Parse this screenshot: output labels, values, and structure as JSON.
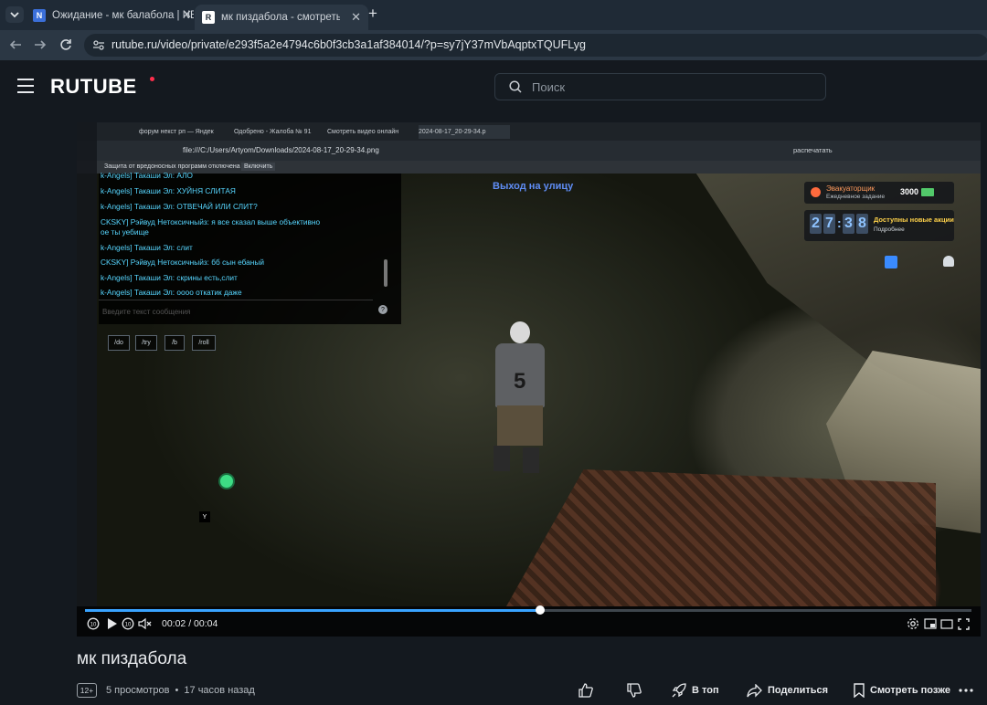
{
  "browser": {
    "tabs": [
      {
        "title": "Ожидание - мк балабола | NE",
        "favicon": "nextrp-icon"
      },
      {
        "title": "мк пиздабола - смотреть виде",
        "favicon": "rutube-icon",
        "active": true
      }
    ],
    "new_tab": "+",
    "url": "rutube.ru/video/private/e293f5a2e4794c6b0f3cb3a1af384014/?p=sy7jY37mVbAqptxTQUFLyg"
  },
  "rutube": {
    "logo": "RUTUBE",
    "search_placeholder": "Поиск"
  },
  "video": {
    "inner_tabs": [
      "форум некст рп — Яндек",
      "Одобрено - Жалоба № 91",
      "Смотреть видео онлайн",
      "2024-08-17_20-29-34.p"
    ],
    "inner_url": "file:///C:/Users/Artyom/Downloads/2024-08-17_20-29-34.png",
    "inner_warning": "Защита от вредоносных программ отключена",
    "inner_enable": "Включить",
    "inner_translate": "распечатать",
    "chat": [
      "k-Angels] Такаши Эл: АЛО",
      "k-Angels] Такаши Эл: ХУЙНЯ СЛИТАЯ",
      "k-Angels] Такаши Эл: ОТВЕЧАЙ ИЛИ СЛИТ?",
      "CKSKY] Рэйвуд Нетоксичныйз: я все сказал выше объективно",
      "ое ты уебище",
      "k-Angels] Такаши Эл: слит",
      "CKSKY] Рэйвуд Нетоксичныйз: бб сын ебаный",
      "k-Angels] Такаши Эл: скрины есть,слит",
      "k-Angels] Такаши Эл: оооо откатик даже"
    ],
    "chat_placeholder": "Введите текст сообщения",
    "commands": [
      "/do",
      "/try",
      "/b",
      "/roll"
    ],
    "exit_label": "Выход на улицу",
    "evac_title": "Эвакуаторщик",
    "evac_sub": "Ежедневное задание",
    "evac_reward": "3000",
    "timer_digits": [
      "2",
      "7",
      "3",
      "8"
    ],
    "promo_title": "Доступны новые акции",
    "promo_sub": "Подробнее",
    "player_letter": "Y",
    "progress": 0.513,
    "time": "00:02 / 00:04"
  },
  "info": {
    "title": "мк пиздабола",
    "age": "12+",
    "views": "5 просмотров",
    "separator": "•",
    "ago": "17 часов назад",
    "actions": {
      "top": "В топ",
      "share": "Поделиться",
      "watch_later": "Смотреть позже"
    }
  }
}
